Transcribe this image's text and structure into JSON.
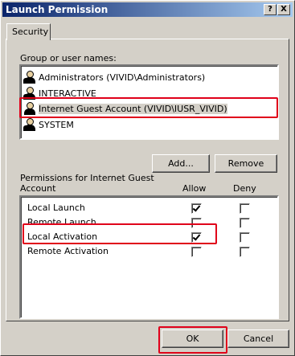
{
  "window": {
    "title": "Launch Permission",
    "help_glyph": "?",
    "close_glyph": "X"
  },
  "tabs": [
    {
      "label": "Security"
    }
  ],
  "groups": {
    "label": "Group or user names:",
    "items": [
      {
        "name": "Administrators (VIVID\\Administrators)"
      },
      {
        "name": "INTERACTIVE"
      },
      {
        "name": "Internet Guest Account (VIVID\\IUSR_VIVID)"
      },
      {
        "name": "SYSTEM"
      }
    ]
  },
  "buttons": {
    "add": "Add...",
    "remove": "Remove",
    "ok": "OK",
    "cancel": "Cancel"
  },
  "permissions": {
    "label_line1": "Permissions for Internet Guest",
    "label_line2": "Account",
    "allow_header": "Allow",
    "deny_header": "Deny",
    "rows": [
      {
        "name": "Local Launch",
        "allow": true,
        "deny": false
      },
      {
        "name": "Remote Launch",
        "allow": false,
        "deny": false
      },
      {
        "name": "Local Activation",
        "allow": true,
        "deny": false
      },
      {
        "name": "Remote Activation",
        "allow": false,
        "deny": false
      }
    ]
  },
  "highlight_color": "#e0001a"
}
